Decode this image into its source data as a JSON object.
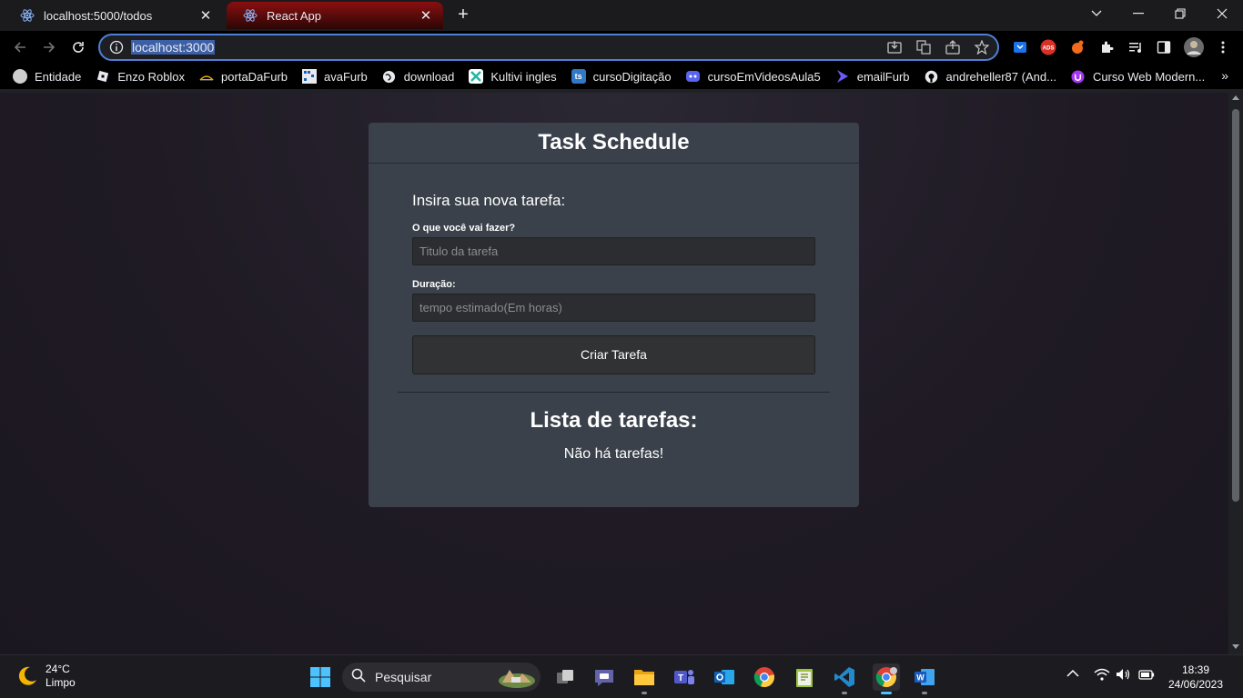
{
  "browser": {
    "tabs": [
      {
        "title": "localhost:5000/todos",
        "close_glyph": "✕"
      },
      {
        "title": "React App",
        "close_glyph": "✕"
      }
    ],
    "new_tab_glyph": "+",
    "address": "localhost:3000",
    "bookmarks": [
      {
        "label": "Entidade",
        "icon": "chatgpt-icon",
        "color": "#cfcfcf"
      },
      {
        "label": "Enzo Roblox",
        "icon": "roblox-icon",
        "color": "#e8eaed"
      },
      {
        "label": "portaDaFurb",
        "icon": "furb-icon",
        "color": "#e8eaed"
      },
      {
        "label": "avaFurb",
        "icon": "ava-icon",
        "color": "#e8eaed"
      },
      {
        "label": "download",
        "icon": "globe-icon",
        "color": "#e8eaed"
      },
      {
        "label": "Kultivi ingles",
        "icon": "kultivi-icon",
        "color": "#1fb8a4"
      },
      {
        "label": "cursoDigitação",
        "icon": "ts-icon",
        "color": "#3178c6",
        "text": "ts"
      },
      {
        "label": "cursoEmVideosAula5",
        "icon": "discord-icon",
        "color": "#5865f2"
      },
      {
        "label": "emailFurb",
        "icon": "power-automate-icon",
        "color": "#6a5cf5"
      },
      {
        "label": "andreheller87 (And...",
        "icon": "github-icon",
        "color": "#e8eaed"
      },
      {
        "label": "Curso Web Modern...",
        "icon": "udemy-icon",
        "color": "#a435f0"
      }
    ],
    "bookmarks_more": "»"
  },
  "app": {
    "title": "Task Schedule",
    "form_heading": "Insira sua nova tarefa:",
    "title_label": "O que você vai fazer?",
    "title_placeholder": "Titulo da tarefa",
    "duration_label": "Duração:",
    "duration_placeholder": "tempo estimado(Em horas)",
    "submit_label": "Criar Tarefa",
    "list_heading": "Lista de tarefas:",
    "empty_message": "Não há tarefas!"
  },
  "taskbar": {
    "weather_temp": "24°C",
    "weather_desc": "Limpo",
    "search_label": "Pesquisar",
    "time": "18:39",
    "date": "24/06/2023"
  }
}
